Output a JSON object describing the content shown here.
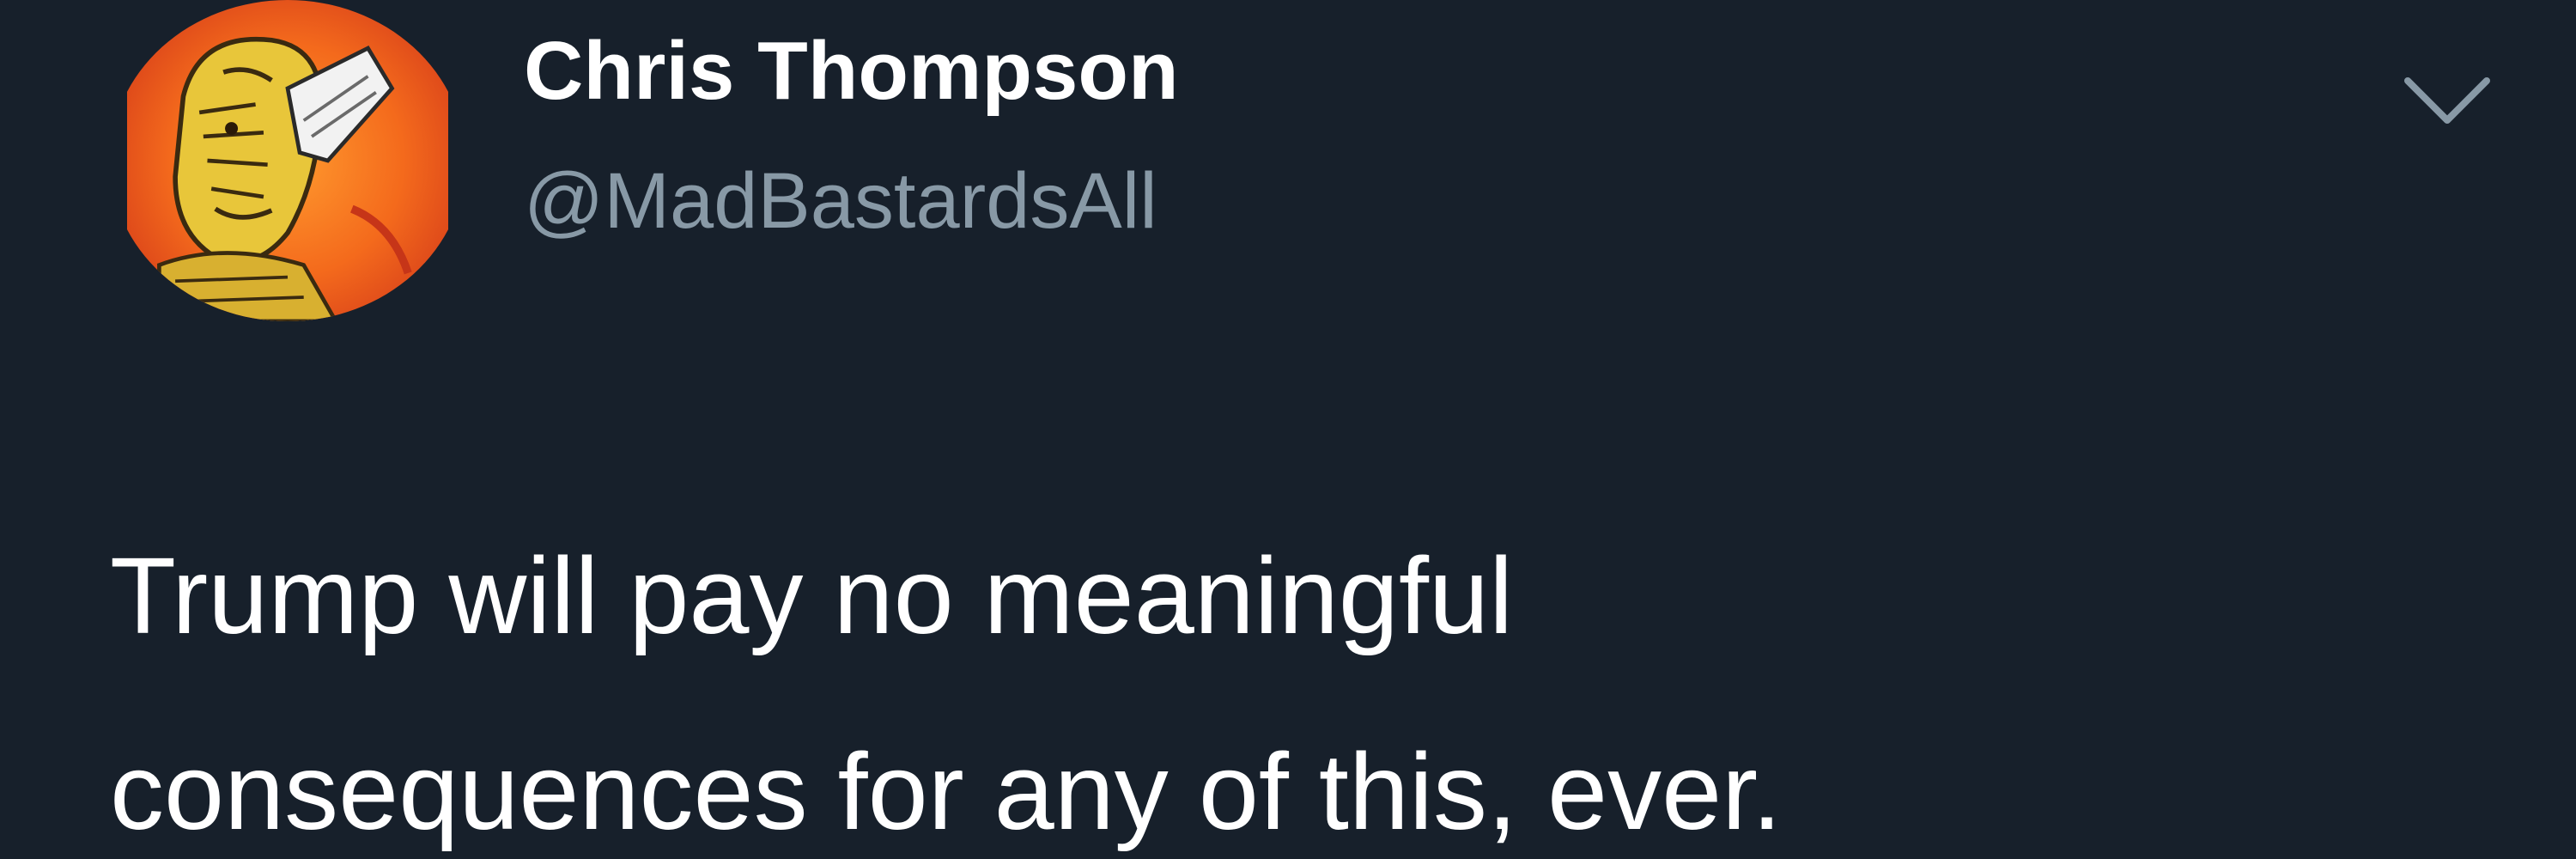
{
  "tweet": {
    "author": {
      "display_name": "Chris Thompson",
      "handle": "@MadBastardsAll",
      "avatar_icon": "profile-avatar"
    },
    "menu_icon": "chevron-down-icon",
    "text": "Trump will pay no meaningful\nconsequences for any of this, ever."
  },
  "colors": {
    "background": "#17202b",
    "primary_text": "#ffffff",
    "secondary_text": "#8899a6"
  }
}
